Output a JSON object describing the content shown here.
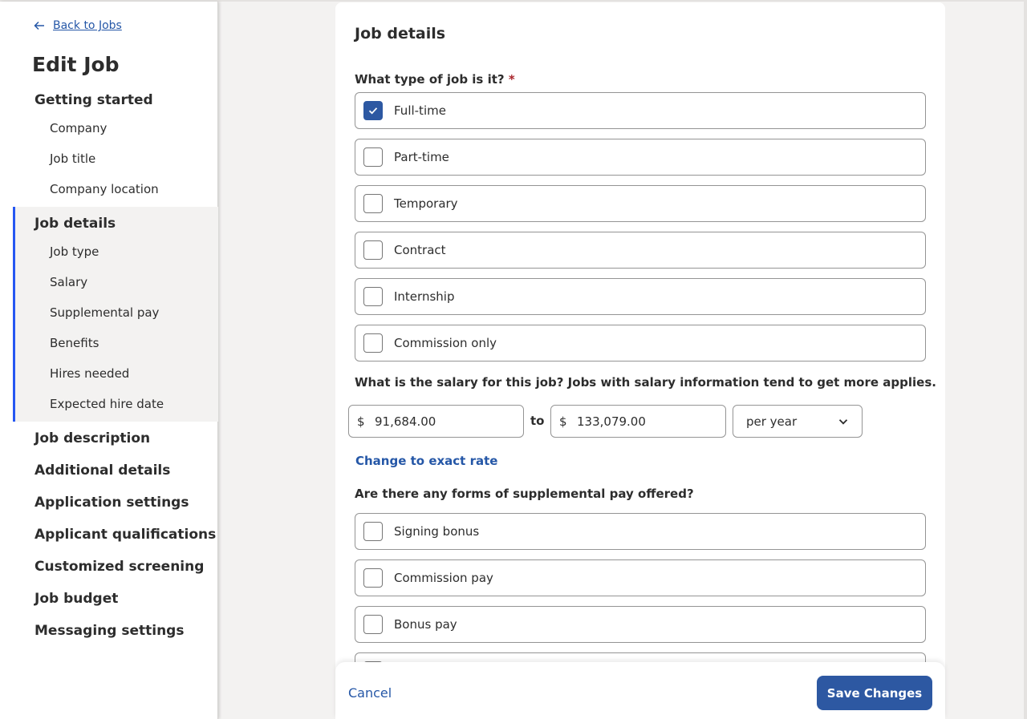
{
  "sidebar": {
    "back_label": "Back to Jobs",
    "title": "Edit Job",
    "sections": [
      {
        "label": "Getting started",
        "items": [
          "Company",
          "Job title",
          "Company location"
        ]
      },
      {
        "label": "Job details",
        "active": true,
        "items": [
          "Job type",
          "Salary",
          "Supplemental pay",
          "Benefits",
          "Hires needed",
          "Expected hire date"
        ]
      },
      {
        "label": "Job description"
      },
      {
        "label": "Additional details"
      },
      {
        "label": "Application settings"
      },
      {
        "label": "Applicant qualifications"
      },
      {
        "label": "Customized screening"
      },
      {
        "label": "Job budget"
      },
      {
        "label": "Messaging settings"
      }
    ]
  },
  "main": {
    "title": "Job details",
    "job_type": {
      "question": "What type of job is it?",
      "required_mark": "*",
      "options": [
        {
          "label": "Full-time",
          "checked": true
        },
        {
          "label": "Part-time",
          "checked": false
        },
        {
          "label": "Temporary",
          "checked": false
        },
        {
          "label": "Contract",
          "checked": false
        },
        {
          "label": "Internship",
          "checked": false
        },
        {
          "label": "Commission only",
          "checked": false
        }
      ]
    },
    "salary": {
      "question": "What is the salary for this job? Jobs with salary information tend to get more applies.",
      "currency": "$",
      "min": "91,684.00",
      "to_label": "to",
      "max": "133,079.00",
      "period": "per year",
      "exact_rate_link": "Change to exact rate"
    },
    "supplemental": {
      "question": "Are there any forms of supplemental pay offered?",
      "options": [
        {
          "label": "Signing bonus",
          "checked": false
        },
        {
          "label": "Commission pay",
          "checked": false
        },
        {
          "label": "Bonus pay",
          "checked": false
        }
      ]
    }
  },
  "footer": {
    "cancel_label": "Cancel",
    "save_label": "Save Changes"
  },
  "colors": {
    "accent": "#2557a7",
    "button": "#2d58a2",
    "active_bar": "#2557f2",
    "required": "#a9252b",
    "background": "#f3f2f1"
  }
}
